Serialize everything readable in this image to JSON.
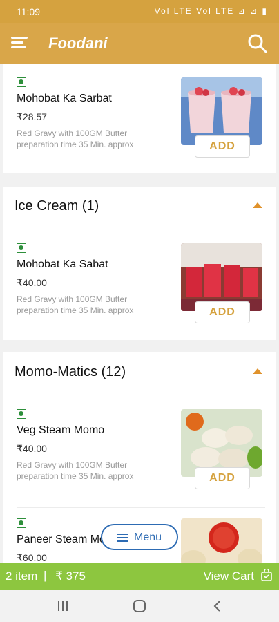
{
  "status": {
    "time": "11:09",
    "icons": "Vol LTE Vol LTE ⊿ ⊿ ▮"
  },
  "app": {
    "title": "Foodani"
  },
  "sections": [
    {
      "title": "",
      "items": [
        {
          "name": "Mohobat Ka Sarbat",
          "price": "₹28.57",
          "desc1": "Red Gravy with 100GM Butter",
          "desc2": "preparation time 35 Min. approx",
          "add": "ADD"
        }
      ]
    },
    {
      "title": "Ice Cream (1)",
      "items": [
        {
          "name": "Mohobat Ka Sabat",
          "price": "₹40.00",
          "desc1": "Red Gravy with 100GM Butter",
          "desc2": "preparation time 35 Min. approx",
          "add": "ADD"
        }
      ]
    },
    {
      "title": "Momo-Matics (12)",
      "items": [
        {
          "name": "Veg Steam Momo",
          "price": "₹40.00",
          "desc1": "Red Gravy with 100GM Butter",
          "desc2": "preparation time 35 Min. approx",
          "add": "ADD"
        },
        {
          "name": "Paneer Steam Momo",
          "price": "₹60.00"
        }
      ]
    }
  ],
  "float_menu": {
    "label": "Menu"
  },
  "cart": {
    "count": "2 item",
    "separator": "|",
    "total": "₹ 375",
    "view": "View Cart"
  },
  "icons": {
    "menu": "hamburger-icon",
    "search": "search-icon",
    "cart": "shopping-bag-icon",
    "veg": "veg-indicator-icon"
  },
  "colors": {
    "appbar": "#d9a649",
    "add_text": "#d5a23f",
    "cartbar": "#8dc63f",
    "menu_accent": "#2d6bb3",
    "veg": "#2e8f3b"
  }
}
